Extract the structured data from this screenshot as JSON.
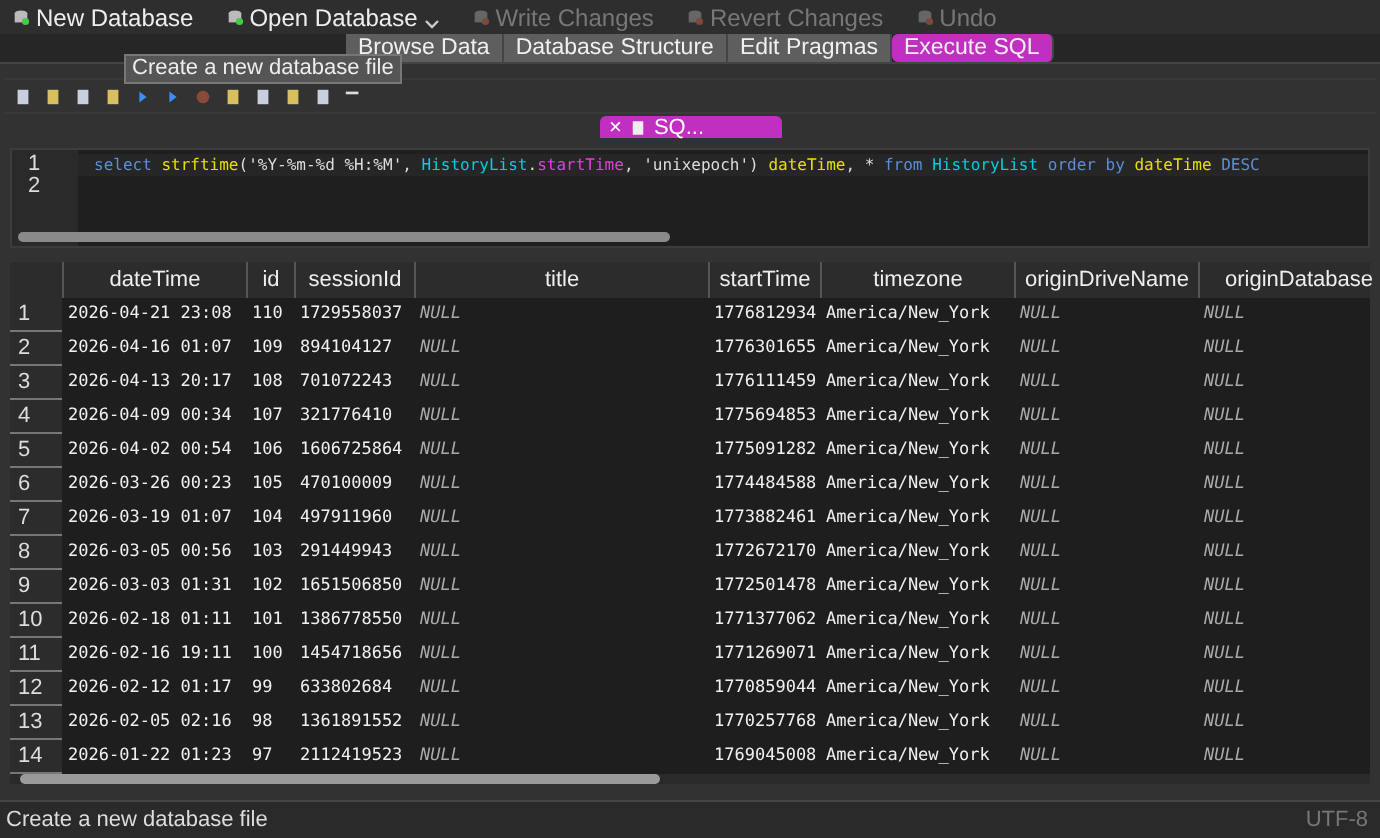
{
  "toolbar": [
    {
      "label": "New Database",
      "disabled": false,
      "caret": false
    },
    {
      "label": "Open Database",
      "disabled": false,
      "caret": true
    },
    {
      "label": "Write Changes",
      "disabled": true,
      "caret": false
    },
    {
      "label": "Revert Changes",
      "disabled": true,
      "caret": false
    },
    {
      "label": "Undo",
      "disabled": true,
      "caret": false
    }
  ],
  "tabs": [
    {
      "label": "Browse Data",
      "selected": false
    },
    {
      "label": "Database Structure",
      "selected": false
    },
    {
      "label": "Edit Pragmas",
      "selected": false
    },
    {
      "label": "Execute SQL",
      "selected": true
    }
  ],
  "tooltip": "Create a new database file",
  "sql_tab": {
    "close": "×",
    "label": "SQ..."
  },
  "editor": {
    "lines": [
      {
        "number": "1",
        "tokens": [
          {
            "text": "select ",
            "kind": "keyword"
          },
          {
            "text": "strftime",
            "kind": "function"
          },
          {
            "text": "('%Y-%m-%d %H:%M', ",
            "kind": "plain"
          },
          {
            "text": "HistoryList",
            "kind": "table"
          },
          {
            "text": ".",
            "kind": "plain"
          },
          {
            "text": "startTime",
            "kind": "field"
          },
          {
            "text": ", 'unixepoch') ",
            "kind": "plain"
          },
          {
            "text": "dateTime",
            "kind": "function"
          },
          {
            "text": ", * ",
            "kind": "plain"
          },
          {
            "text": "from ",
            "kind": "keyword"
          },
          {
            "text": "HistoryList ",
            "kind": "table"
          },
          {
            "text": "order by ",
            "kind": "keyword"
          },
          {
            "text": "dateTime ",
            "kind": "function"
          },
          {
            "text": "DESC",
            "kind": "keyword"
          }
        ]
      },
      {
        "number": "2"
      }
    ]
  },
  "table": {
    "columns": [
      "dateTime",
      "id",
      "sessionId",
      "title",
      "startTime",
      "timezone",
      "originDriveName",
      "originDatabase"
    ],
    "rows": [
      {
        "number": "1",
        "cells": [
          {
            "text": "2026-04-21 23:08",
            "null": false
          },
          {
            "text": "110",
            "null": false
          },
          {
            "text": "1729558037",
            "null": false
          },
          {
            "text": "NULL",
            "null": true
          },
          {
            "text": "1776812934",
            "null": false
          },
          {
            "text": "America/New_York",
            "null": false
          },
          {
            "text": "NULL",
            "null": true
          },
          {
            "text": "NULL",
            "null": true
          }
        ]
      },
      {
        "number": "2",
        "cells": [
          {
            "text": "2026-04-16 01:07",
            "null": false
          },
          {
            "text": "109",
            "null": false
          },
          {
            "text": "894104127",
            "null": false
          },
          {
            "text": "NULL",
            "null": true
          },
          {
            "text": "1776301655",
            "null": false
          },
          {
            "text": "America/New_York",
            "null": false
          },
          {
            "text": "NULL",
            "null": true
          },
          {
            "text": "NULL",
            "null": true
          }
        ]
      },
      {
        "number": "3",
        "cells": [
          {
            "text": "2026-04-13 20:17",
            "null": false
          },
          {
            "text": "108",
            "null": false
          },
          {
            "text": "701072243",
            "null": false
          },
          {
            "text": "NULL",
            "null": true
          },
          {
            "text": "1776111459",
            "null": false
          },
          {
            "text": "America/New_York",
            "null": false
          },
          {
            "text": "NULL",
            "null": true
          },
          {
            "text": "NULL",
            "null": true
          }
        ]
      },
      {
        "number": "4",
        "cells": [
          {
            "text": "2026-04-09 00:34",
            "null": false
          },
          {
            "text": "107",
            "null": false
          },
          {
            "text": "321776410",
            "null": false
          },
          {
            "text": "NULL",
            "null": true
          },
          {
            "text": "1775694853",
            "null": false
          },
          {
            "text": "America/New_York",
            "null": false
          },
          {
            "text": "NULL",
            "null": true
          },
          {
            "text": "NULL",
            "null": true
          }
        ]
      },
      {
        "number": "5",
        "cells": [
          {
            "text": "2026-04-02 00:54",
            "null": false
          },
          {
            "text": "106",
            "null": false
          },
          {
            "text": "1606725864",
            "null": false
          },
          {
            "text": "NULL",
            "null": true
          },
          {
            "text": "1775091282",
            "null": false
          },
          {
            "text": "America/New_York",
            "null": false
          },
          {
            "text": "NULL",
            "null": true
          },
          {
            "text": "NULL",
            "null": true
          }
        ]
      },
      {
        "number": "6",
        "cells": [
          {
            "text": "2026-03-26 00:23",
            "null": false
          },
          {
            "text": "105",
            "null": false
          },
          {
            "text": "470100009",
            "null": false
          },
          {
            "text": "NULL",
            "null": true
          },
          {
            "text": "1774484588",
            "null": false
          },
          {
            "text": "America/New_York",
            "null": false
          },
          {
            "text": "NULL",
            "null": true
          },
          {
            "text": "NULL",
            "null": true
          }
        ]
      },
      {
        "number": "7",
        "cells": [
          {
            "text": "2026-03-19 01:07",
            "null": false
          },
          {
            "text": "104",
            "null": false
          },
          {
            "text": "497911960",
            "null": false
          },
          {
            "text": "NULL",
            "null": true
          },
          {
            "text": "1773882461",
            "null": false
          },
          {
            "text": "America/New_York",
            "null": false
          },
          {
            "text": "NULL",
            "null": true
          },
          {
            "text": "NULL",
            "null": true
          }
        ]
      },
      {
        "number": "8",
        "cells": [
          {
            "text": "2026-03-05 00:56",
            "null": false
          },
          {
            "text": "103",
            "null": false
          },
          {
            "text": "291449943",
            "null": false
          },
          {
            "text": "NULL",
            "null": true
          },
          {
            "text": "1772672170",
            "null": false
          },
          {
            "text": "America/New_York",
            "null": false
          },
          {
            "text": "NULL",
            "null": true
          },
          {
            "text": "NULL",
            "null": true
          }
        ]
      },
      {
        "number": "9",
        "cells": [
          {
            "text": "2026-03-03 01:31",
            "null": false
          },
          {
            "text": "102",
            "null": false
          },
          {
            "text": "1651506850",
            "null": false
          },
          {
            "text": "NULL",
            "null": true
          },
          {
            "text": "1772501478",
            "null": false
          },
          {
            "text": "America/New_York",
            "null": false
          },
          {
            "text": "NULL",
            "null": true
          },
          {
            "text": "NULL",
            "null": true
          }
        ]
      },
      {
        "number": "10",
        "cells": [
          {
            "text": "2026-02-18 01:11",
            "null": false
          },
          {
            "text": "101",
            "null": false
          },
          {
            "text": "1386778550",
            "null": false
          },
          {
            "text": "NULL",
            "null": true
          },
          {
            "text": "1771377062",
            "null": false
          },
          {
            "text": "America/New_York",
            "null": false
          },
          {
            "text": "NULL",
            "null": true
          },
          {
            "text": "NULL",
            "null": true
          }
        ]
      },
      {
        "number": "11",
        "cells": [
          {
            "text": "2026-02-16 19:11",
            "null": false
          },
          {
            "text": "100",
            "null": false
          },
          {
            "text": "1454718656",
            "null": false
          },
          {
            "text": "NULL",
            "null": true
          },
          {
            "text": "1771269071",
            "null": false
          },
          {
            "text": "America/New_York",
            "null": false
          },
          {
            "text": "NULL",
            "null": true
          },
          {
            "text": "NULL",
            "null": true
          }
        ]
      },
      {
        "number": "12",
        "cells": [
          {
            "text": "2026-02-12 01:17",
            "null": false
          },
          {
            "text": "99",
            "null": false
          },
          {
            "text": "633802684",
            "null": false
          },
          {
            "text": "NULL",
            "null": true
          },
          {
            "text": "1770859044",
            "null": false
          },
          {
            "text": "America/New_York",
            "null": false
          },
          {
            "text": "NULL",
            "null": true
          },
          {
            "text": "NULL",
            "null": true
          }
        ]
      },
      {
        "number": "13",
        "cells": [
          {
            "text": "2026-02-05 02:16",
            "null": false
          },
          {
            "text": "98",
            "null": false
          },
          {
            "text": "1361891552",
            "null": false
          },
          {
            "text": "NULL",
            "null": true
          },
          {
            "text": "1770257768",
            "null": false
          },
          {
            "text": "America/New_York",
            "null": false
          },
          {
            "text": "NULL",
            "null": true
          },
          {
            "text": "NULL",
            "null": true
          }
        ]
      },
      {
        "number": "14",
        "cells": [
          {
            "text": "2026-01-22 01:23",
            "null": false
          },
          {
            "text": "97",
            "null": false
          },
          {
            "text": "2112419523",
            "null": false
          },
          {
            "text": "NULL",
            "null": true
          },
          {
            "text": "1769045008",
            "null": false
          },
          {
            "text": "America/New_York",
            "null": false
          },
          {
            "text": "NULL",
            "null": true
          },
          {
            "text": "NULL",
            "null": true
          }
        ]
      }
    ]
  },
  "status_bar": {
    "message": "Create a new database file",
    "encoding": "UTF-8"
  }
}
